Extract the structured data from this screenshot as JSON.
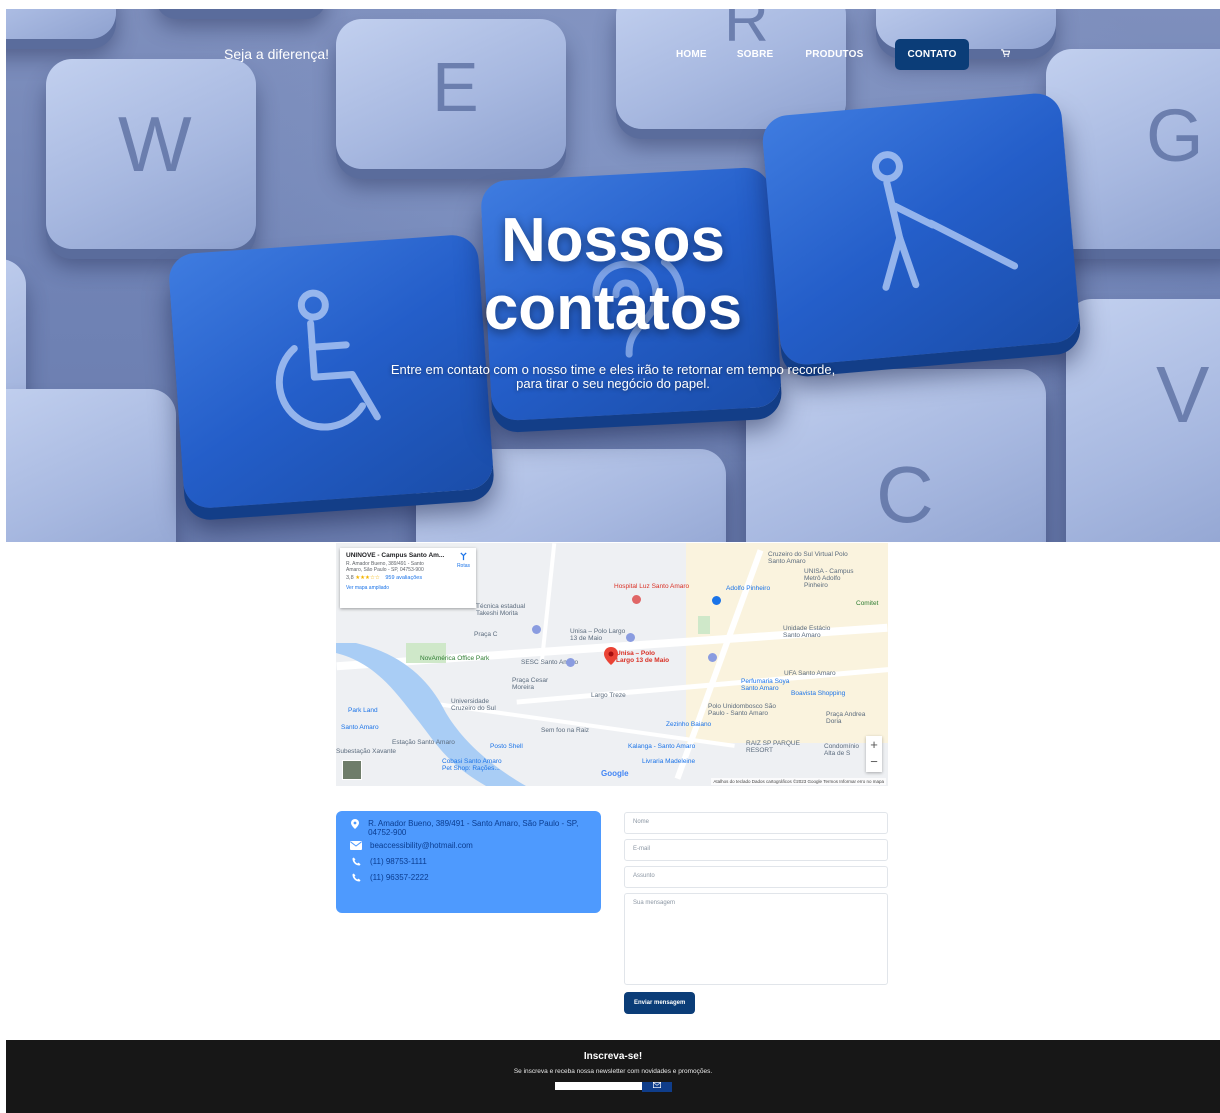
{
  "header": {
    "brand": "Seja a diferença!",
    "nav": [
      {
        "label": "HOME"
      },
      {
        "label": "SOBRE"
      },
      {
        "label": "PRODUTOS"
      },
      {
        "label": "CONTATO",
        "active": true
      }
    ],
    "cart_icon": "cart-icon"
  },
  "hero": {
    "title_line1": "Nossos",
    "title_line2": "contatos",
    "subtitle_line1": "Entre em contato com o nosso time e eles irão te retornar em tempo recorde,",
    "subtitle_line2": "para tirar o seu negócio do papel.",
    "keys": [
      "W",
      "E",
      "R",
      "G",
      "C",
      "V"
    ]
  },
  "map": {
    "place_name": "UNINOVE - Campus Santo Am...",
    "address": "R. Amador Bueno, 389/491 - Santo Amaro, São Paulo - SP, 04753-900",
    "rating": "3,8",
    "stars": "★★★☆☆",
    "reviews": "959 avaliações",
    "directions": "Rotas",
    "larger_map": "Ver mapa ampliado",
    "pin_label": "UNINOVE - Campus Santo Amaro",
    "labels": {
      "hospital": "Hospital Luz Santo Amaro",
      "adolfo": "Adolfo Pinheiro",
      "cruzeiro": "Cruzeiro do Sul Virtual Polo Santo Amaro",
      "unisa_metro": "UNISA - Campus Metrô Adolfo Pinheiro",
      "tecnica": "Técnica estadual Takeshi Morita",
      "praca_c": "Praça C",
      "unisa_polo": "Unisa – Polo Largo 13 de Maio",
      "estacio": "Unidade Estácio Santo Amaro",
      "novamerica": "NovAmérica Office Park",
      "sesc": "SESC Santo Amaro",
      "praca_cesar": "Praça Cesar Moreira",
      "largo_treze": "Largo Treze",
      "ufa": "UFA Santo Amaro",
      "perfumaria": "Perfumaria Soya Santo Amaro",
      "boavista": "Boavista Shopping",
      "univ_cruzeiro": "Universidade Cruzeiro do Sul",
      "unidombosco": "Polo Unidombosco São Paulo - Santo Amaro",
      "park_land": "Park Land",
      "santo_amaro": "Santo Amaro",
      "estacao": "Estação Santo Amaro",
      "zezinho": "Zezinho Baiano",
      "sem_foo": "Sem foo na Raiz",
      "praca_andrea": "Praça Andrea Doria",
      "posto": "Posto Shell",
      "kalanga": "Kalanga - Santo Amaro",
      "raiz": "RAIZ SP PARQUE RESORT",
      "condominio": "Condomínio Alta de S",
      "cobasi": "Cobasi Santo Amaro Pet Shop: Rações...",
      "livraria": "Livraria Madeleine",
      "subestacao": "Subestação Xavante",
      "comitet": "Comitet"
    },
    "google": "Google",
    "footer_text": "Atalhos do teclado   Dados cartográficos ©2023 Google   Termos   Informar erro no mapa",
    "zoom_in": "+",
    "zoom_out": "−"
  },
  "contact": {
    "address": "R. Amador Bueno, 389/491 - Santo Amaro, São Paulo - SP, 04752-900",
    "email": "beaccessibility@hotmail.com",
    "phone1": "(11) 98753-1111",
    "phone2": "(11) 96357-2222"
  },
  "form": {
    "name_placeholder": "Nome",
    "email_placeholder": "E-mail",
    "subject_placeholder": "Assunto",
    "message_placeholder": "Sua mensagem",
    "submit": "Enviar mensagem"
  },
  "footer": {
    "title": "Inscreva-se!",
    "subtitle": "Se inscreva e receba nossa newsletter com novidades e promoções.",
    "submit_icon": "envelope-icon"
  }
}
